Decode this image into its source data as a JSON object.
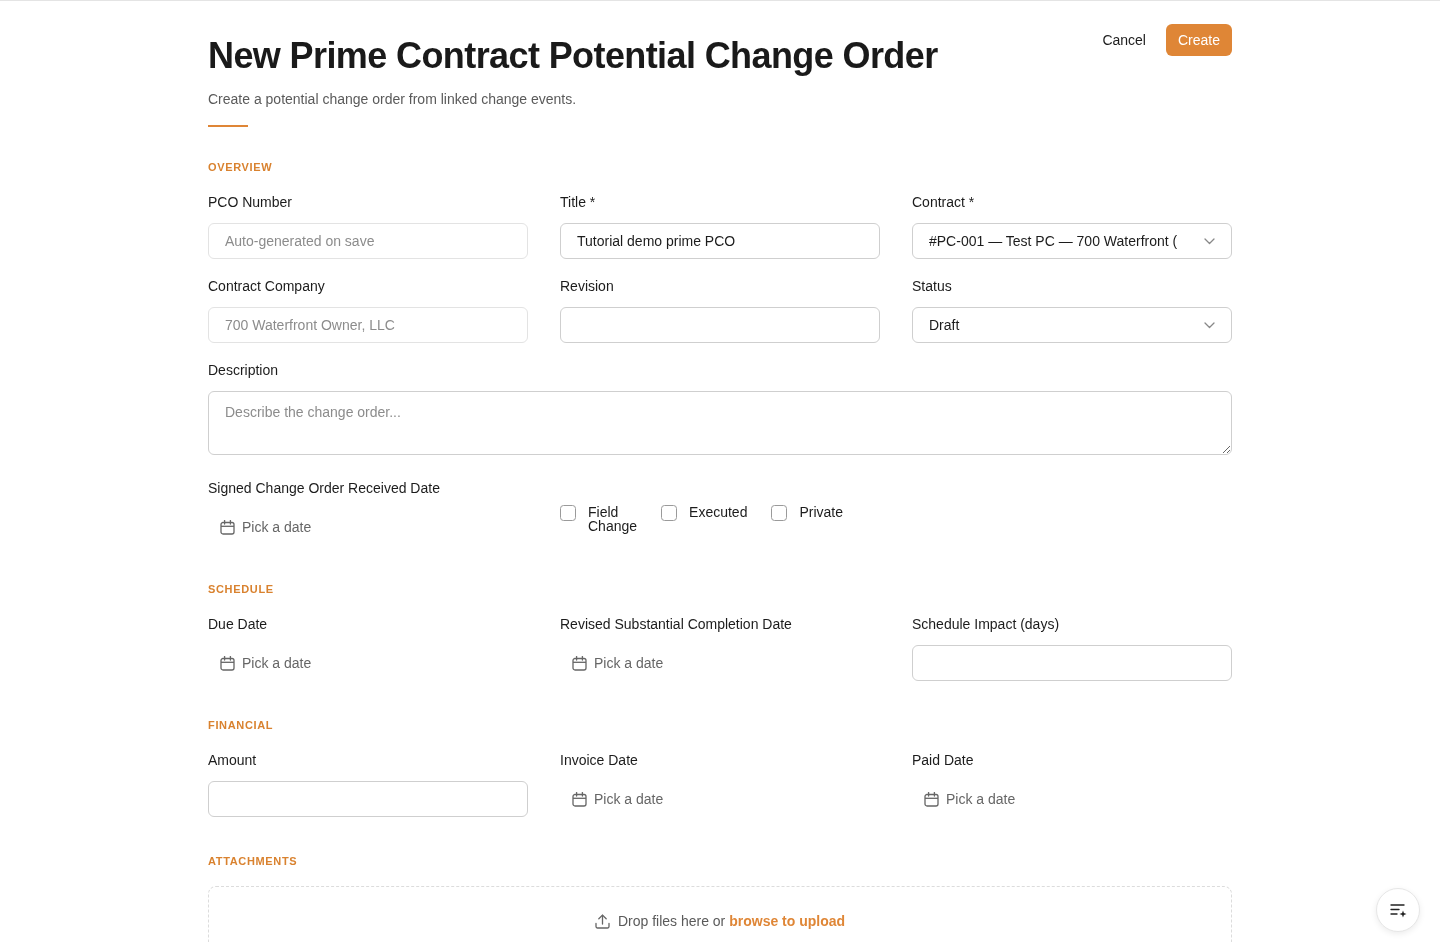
{
  "header": {
    "title": "New Prime Contract Potential Change Order",
    "subtitle": "Create a potential change order from linked change events.",
    "actions": [
      {
        "label": "Cancel",
        "kind": "ghost"
      },
      {
        "label": "Create",
        "kind": "primary"
      }
    ]
  },
  "sections": [
    {
      "heading": "OVERVIEW",
      "fields": [
        {
          "kind": "input",
          "label": "PCO Number",
          "placeholder": "Auto-generated on save",
          "disabled": true
        },
        {
          "kind": "input",
          "label": "Title *",
          "value": "Tutorial demo prime PCO",
          "disabled": false
        },
        {
          "kind": "select",
          "label": "Contract *",
          "value": "#PC-001 — Test PC — 700 Waterfront ("
        },
        {
          "kind": "input",
          "label": "Contract Company",
          "value": "700 Waterfront Owner, LLC",
          "disabled": true
        },
        {
          "kind": "input",
          "label": "Revision",
          "disabled": false
        },
        {
          "kind": "select",
          "label": "Status",
          "value": "Draft"
        },
        {
          "kind": "textarea",
          "label": "Description",
          "placeholder": "Describe the change order..."
        },
        {
          "kind": "date",
          "label": "Signed Change Order Received Date",
          "placeholder": "Pick a date"
        },
        {
          "kind": "checkboxes",
          "items": [
            {
              "label": "Field Change",
              "checked": false
            },
            {
              "label": "Executed",
              "checked": false
            },
            {
              "label": "Private",
              "checked": false
            }
          ]
        }
      ]
    },
    {
      "heading": "SCHEDULE",
      "fields": [
        {
          "kind": "date",
          "label": "Due Date",
          "placeholder": "Pick a date"
        },
        {
          "kind": "date",
          "label": "Revised Substantial Completion Date",
          "placeholder": "Pick a date"
        },
        {
          "kind": "input",
          "label": "Schedule Impact (days)",
          "disabled": false
        }
      ]
    },
    {
      "heading": "FINANCIAL",
      "fields": [
        {
          "kind": "input",
          "label": "Amount",
          "disabled": false
        },
        {
          "kind": "date",
          "label": "Invoice Date",
          "placeholder": "Pick a date"
        },
        {
          "kind": "date",
          "label": "Paid Date",
          "placeholder": "Pick a date"
        }
      ]
    },
    {
      "heading": "ATTACHMENTS",
      "dropzone": {
        "prompt": "Drop files here or",
        "link": "browse to upload"
      }
    }
  ]
}
